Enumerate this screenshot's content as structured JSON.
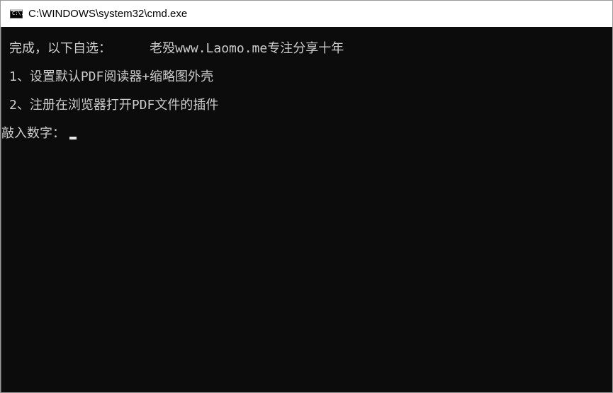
{
  "window": {
    "title": "C:\\WINDOWS\\system32\\cmd.exe",
    "icon": "cmd-icon",
    "icon_label": "C:\\."
  },
  "console": {
    "lines": [
      "完成，以下自选：     老殁www.Laomo.me专注分享十年",
      "1、设置默认PDF阅读器+缩略图外壳",
      "2、注册在浏览器打开PDF文件的插件"
    ],
    "prompt": "敲入数字："
  },
  "colors": {
    "background": "#0c0c0c",
    "text": "#cccccc",
    "titlebar": "#ffffff"
  }
}
